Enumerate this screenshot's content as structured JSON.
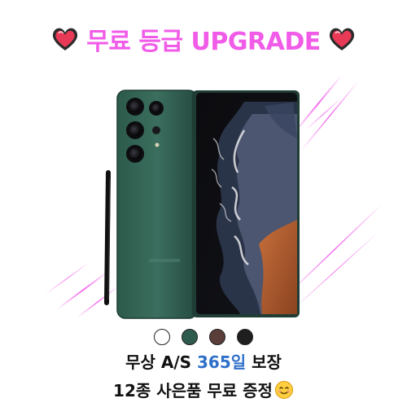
{
  "headline": {
    "text": "무료 등급 UPGRADE",
    "color": "#f05be8",
    "left_icon": "heart-icon",
    "right_icon": "heart-icon"
  },
  "product": {
    "image": "phone-with-stylus"
  },
  "colors": {
    "options": [
      {
        "name": "white-swatch",
        "hex": "#ffffff"
      },
      {
        "name": "green-swatch",
        "hex": "#2f5a4e"
      },
      {
        "name": "burgundy-swatch",
        "hex": "#5b3d3a"
      },
      {
        "name": "black-swatch",
        "hex": "#1f1f1f"
      }
    ]
  },
  "benefits": {
    "as_prefix": "무상 A/S ",
    "as_highlight": "365일",
    "as_suffix": " 보장",
    "gifts": "12종 사은품 무료 증정",
    "gifts_icon": "smiley-icon"
  }
}
